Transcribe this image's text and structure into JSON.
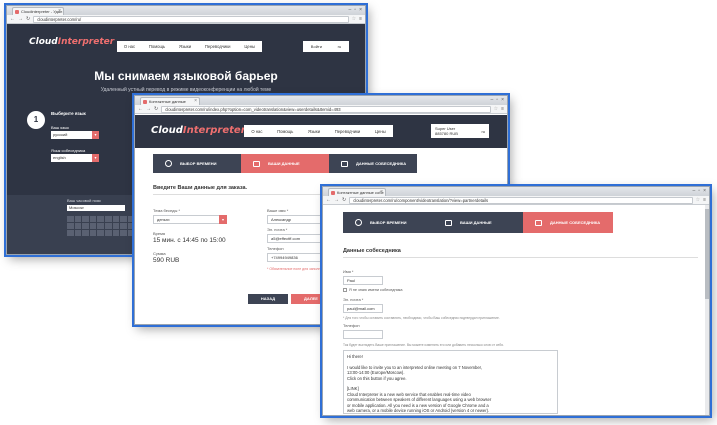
{
  "colors": {
    "dark": "#2e3443",
    "accent": "#e46b6b",
    "grey_step": "#3d4454"
  },
  "w1": {
    "tab_title": "Cloudinterpreter - Удал",
    "url": "cloudinterpreter.com/ru/",
    "logo_a": "Cloud",
    "logo_b": "Interpreter",
    "nav": [
      "О нас",
      "Помощь",
      "Языки",
      "Переводчики",
      "Цены"
    ],
    "login": "Войти",
    "lang": "ru",
    "hero_title": "Мы снимаем языковой барьер",
    "hero_sub": "Удаленный устный перевод в режиме видеоконференции на любой теме",
    "step_number": "1",
    "choose_language": "Выберите язык",
    "your_language": "Ваш язык",
    "your_language_value": "русский",
    "partner_language": "Язык собеседника",
    "partner_language_value": "english",
    "timezone_label": "Ваш часовой пояс",
    "timezone_value": "Moscow"
  },
  "w2": {
    "tab_title": "Контактные данные",
    "url": "cloudinterpreter.com/ru/index.php?option=com_videotranslation&view=userdetails&Itemid=493",
    "logo_a": "Cloud",
    "logo_b": "Interpreter",
    "nav": [
      "О нас",
      "Помощь",
      "Языки",
      "Переводчики",
      "Цены"
    ],
    "user_label": "Super User",
    "user_balance": "885780 RUB",
    "lang": "ru",
    "steps": [
      "ВЫБОР ВРЕМЕНИ",
      "ВАШИ ДАННЫЕ",
      "ДАННЫЕ СОБЕСЕДНИКА"
    ],
    "form_title": "Введите Ваши данные для заказа.",
    "topic_label": "Тема беседы *",
    "topic_value": "деньги",
    "time_label": "Время",
    "time_value": "15 мин. с 14:45 по 15:00",
    "sum_label": "Сумма",
    "sum_value": "590 RUB",
    "name_label": "Ваше имя *",
    "name_value": "Александр",
    "email_label": "Эл. почта *",
    "email_value": "a5@effectff.com",
    "phone_label": "Телефон",
    "phone_value": "+74994949836",
    "required_note": "* Обязательное поле для заполнения",
    "back_button": "НАЗАД",
    "next_button": "ДАЛЕЕ"
  },
  "w3": {
    "tab_title": "Контактные данные собе",
    "url": "cloudinterpreter.com/ru/component/videotranslation/?view=partnerdetails",
    "steps": [
      "ВЫБОР ВРЕМЕНИ",
      "ВАШИ ДАННЫЕ",
      "ДАННЫЕ СОБЕСЕДНИКА"
    ],
    "section_title": "Данные собеседника",
    "name_label": "Имя *",
    "name_value": "Paul",
    "no_name_checkbox": "Я не знаю имени собеседника",
    "email_label": "Эл. почта *",
    "email_value": "paul@mail.com",
    "email_hint": "* Для того чтобы оставить составлять, необходимо, чтобы Ваш собеседник подтвердил приглашение.",
    "phone_label": "Телефон",
    "invite_note": "Так будет выглядеть Ваше приглашение. Вы можете изменить его или добавить несколько слов от себя.",
    "letter_lines": [
      "Hi there!",
      "",
      "I would like to invite you to an interpreted online meeting on 7 November,",
      "13:00-14:00 (Europe/Moscow).",
      "Click on this button if you agree.",
      "",
      "[LINK]",
      "Cloud Interpreter is a new web service that enables real-time video",
      "communication between speakers of different languages using a web browser",
      "or mobile application. All you need is a new version of Google Chrome and a",
      "web camera, or a mobile device running iOS or Android (version 4 or newer)."
    ]
  }
}
